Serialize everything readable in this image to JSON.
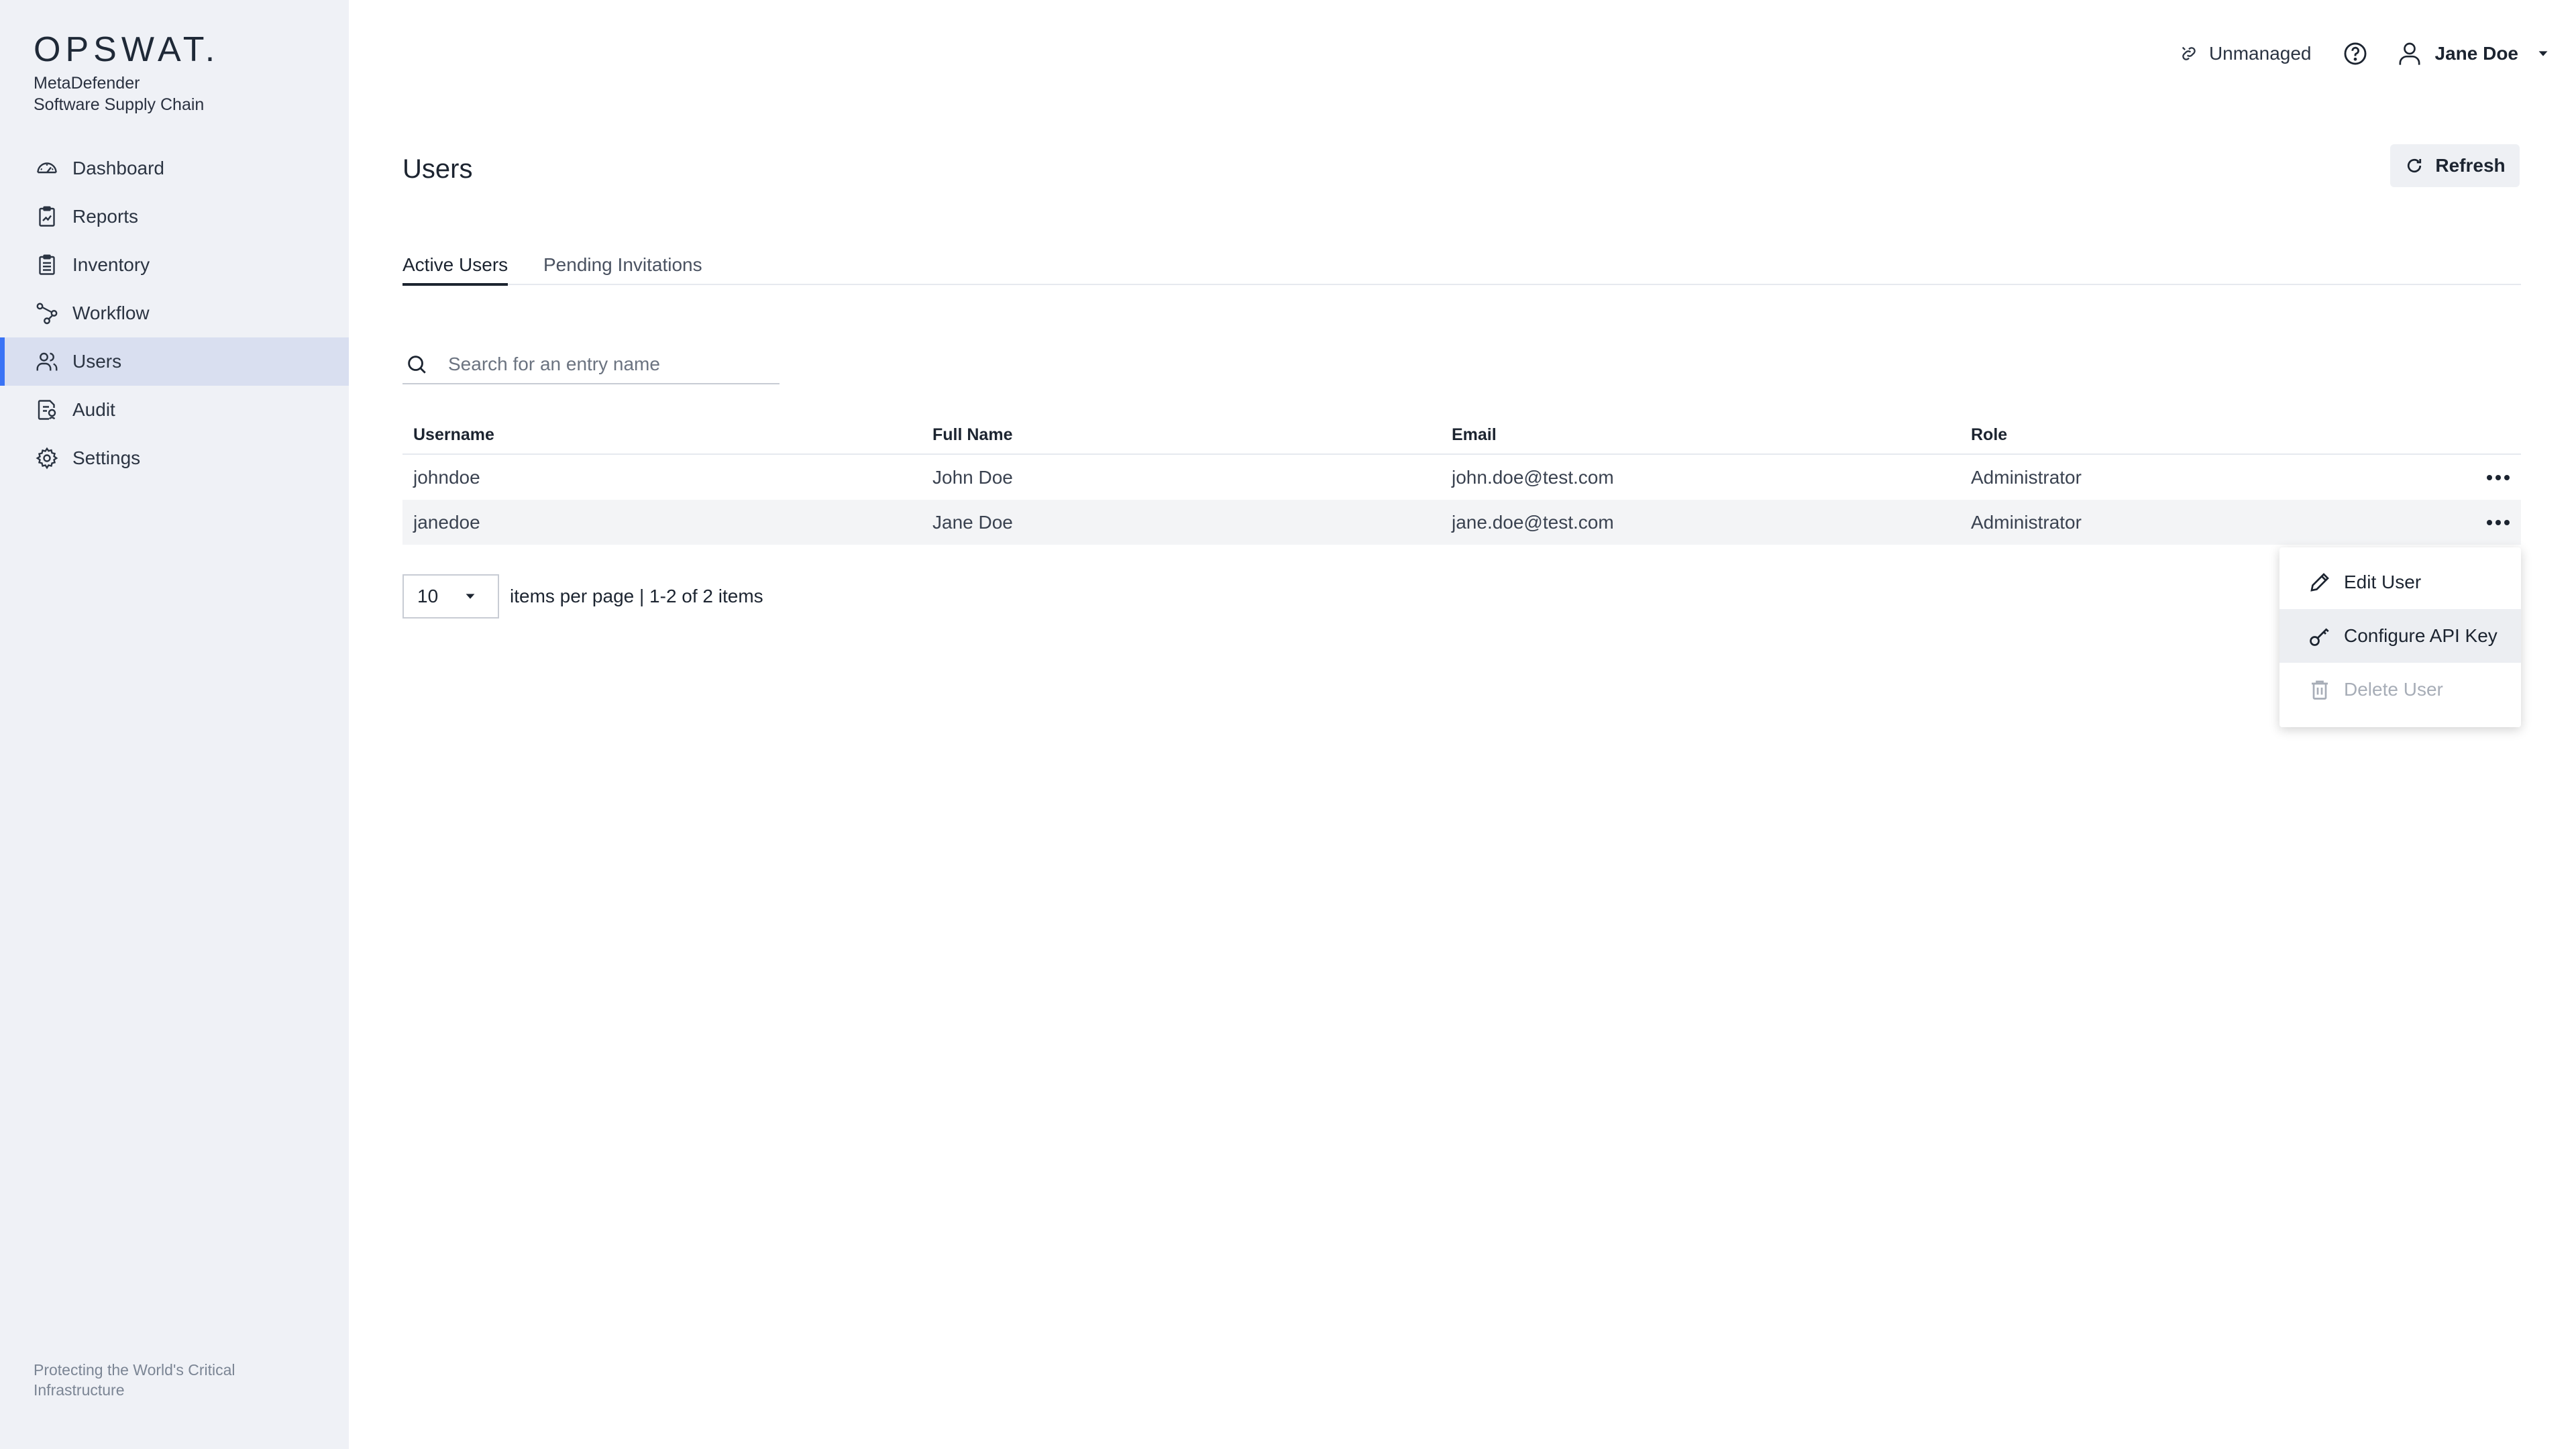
{
  "brand": {
    "logo": "OPSWAT.",
    "product_line1": "MetaDefender",
    "product_line2": "Software Supply Chain",
    "footer": "Protecting the World's Critical Infrastructure"
  },
  "sidebar": {
    "items": [
      {
        "label": "Dashboard",
        "icon": "dashboard-icon"
      },
      {
        "label": "Reports",
        "icon": "reports-icon"
      },
      {
        "label": "Inventory",
        "icon": "inventory-icon"
      },
      {
        "label": "Workflow",
        "icon": "workflow-icon"
      },
      {
        "label": "Users",
        "icon": "users-icon",
        "active": true
      },
      {
        "label": "Audit",
        "icon": "audit-icon"
      },
      {
        "label": "Settings",
        "icon": "settings-icon"
      }
    ],
    "accent": "#3a73f5"
  },
  "topbar": {
    "unmanaged": "Unmanaged",
    "user_name": "Jane Doe"
  },
  "page": {
    "title": "Users",
    "refresh_label": "Refresh"
  },
  "tabs": [
    {
      "label": "Active Users",
      "active": true
    },
    {
      "label": "Pending Invitations",
      "active": false
    }
  ],
  "search": {
    "placeholder": "Search for an entry name",
    "value": ""
  },
  "table": {
    "columns": [
      "Username",
      "Full Name",
      "Email",
      "Role"
    ],
    "rows": [
      {
        "username": "johndoe",
        "full_name": "John Doe",
        "email": "john.doe@test.com",
        "role": "Administrator"
      },
      {
        "username": "janedoe",
        "full_name": "Jane Doe",
        "email": "jane.doe@test.com",
        "role": "Administrator"
      }
    ]
  },
  "pagination": {
    "per_page": "10",
    "summary": "items per page | 1-2 of 2 items"
  },
  "context_menu": {
    "items": [
      {
        "label": "Edit User",
        "icon": "pencil-icon"
      },
      {
        "label": "Configure API Key",
        "icon": "key-icon"
      },
      {
        "label": "Delete User",
        "icon": "trash-icon",
        "disabled": true
      }
    ]
  }
}
